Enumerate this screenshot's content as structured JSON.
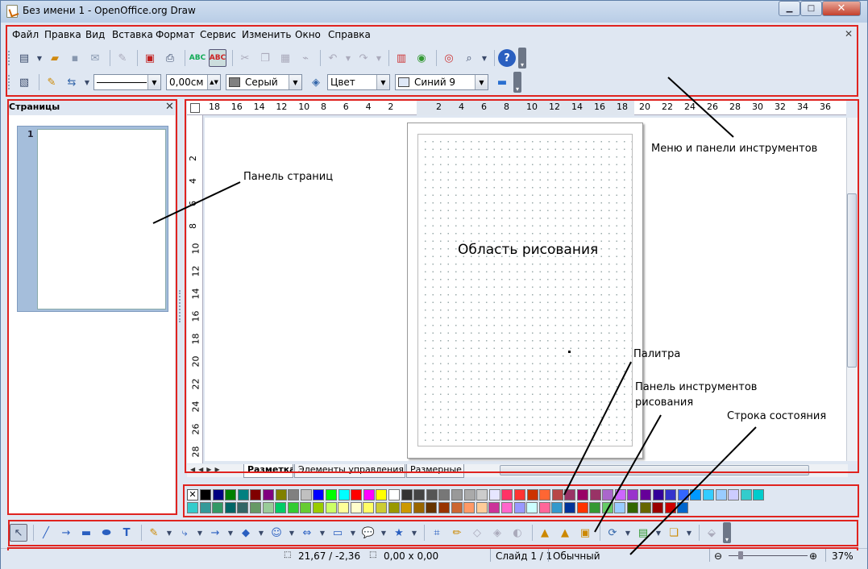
{
  "window": {
    "title": "Без имени 1 - OpenOffice.org Draw",
    "minimize": "▁",
    "maximize": "□",
    "close": "✕"
  },
  "menu": [
    "Файл",
    "Правка",
    "Вид",
    "Вставка",
    "Формат",
    "Сервис",
    "Изменить",
    "Окно",
    "Справка"
  ],
  "menu_close": "✕",
  "toolbar2": {
    "line_width": "0,00см",
    "area_color": "Серый",
    "area_style": "Цвет",
    "area_fill": "Синий 9"
  },
  "pages_panel": {
    "title": "Страницы",
    "close": "✕",
    "page_number": "1"
  },
  "ruler_h": [
    "18",
    "16",
    "14",
    "12",
    "10",
    "8",
    "6",
    "4",
    "2",
    "2",
    "4",
    "6",
    "8",
    "10",
    "12",
    "14",
    "16",
    "18",
    "20",
    "22",
    "24",
    "26",
    "28",
    "30",
    "32",
    "34",
    "36"
  ],
  "ruler_v": [
    "2",
    "4",
    "6",
    "8",
    "10",
    "12",
    "14",
    "16",
    "18",
    "20",
    "22",
    "24",
    "26",
    "28"
  ],
  "tabs": [
    "Разметка",
    "Элементы управления",
    "Размерные"
  ],
  "annotations": {
    "menu": "Меню и панели инструментов",
    "pages": "Панель страниц",
    "drawing": "Область рисования",
    "palette": "Палитра",
    "draw_tb": "Панель инструментов рисования",
    "status": "Строка состояния"
  },
  "status": {
    "position": "21,67 / -2,36",
    "size": "0,00 x 0,00",
    "slide": "Слайд 1 / 1",
    "layout": "Обычный",
    "zoom": "37%"
  },
  "colors": {
    "accent_red": "#e0231f",
    "window_bg": "#dfe7f2"
  },
  "palette": [
    "#000000",
    "#000080",
    "#008000",
    "#008080",
    "#800000",
    "#800080",
    "#808000",
    "#808080",
    "#c0c0c0",
    "#0000ff",
    "#00ff00",
    "#00ffff",
    "#ff0000",
    "#ff00ff",
    "#ffff00",
    "#ffffff",
    "#333333",
    "#444444",
    "#555555",
    "#777777",
    "#999999",
    "#aaaaaa",
    "#cccccc",
    "#e6e6ff",
    "#ff3366",
    "#ff3333",
    "#cc3300",
    "#ff6633",
    "#b84747",
    "#993366",
    "#990066",
    "#993366",
    "#aa66cc",
    "#cc66ff",
    "#9933cc",
    "#660099",
    "#330099",
    "#3333cc",
    "#3366ff",
    "#0099ff",
    "#33ccff",
    "#99ccff",
    "#ccccff",
    "#33cccc",
    "#00cccc",
    "#33cccc",
    "#339999",
    "#339966",
    "#006666",
    "#336666",
    "#669966",
    "#99cc99",
    "#00cc66",
    "#33cc33",
    "#66cc33",
    "#99cc00",
    "#ccff66",
    "#ffff99",
    "#ffffcc",
    "#ffff66",
    "#cccc33",
    "#999900",
    "#cc9900",
    "#996600",
    "#663300",
    "#993300",
    "#cc6633",
    "#ff9966",
    "#ffcc99",
    "#cc3399",
    "#ff66cc",
    "#9999ff",
    "#ccffff",
    "#ff6699",
    "#3399cc",
    "#003399",
    "#ff3300",
    "#339933",
    "#66cc66",
    "#99ccff",
    "#336600",
    "#666600",
    "#990000",
    "#cc0000",
    "#0066cc"
  ]
}
